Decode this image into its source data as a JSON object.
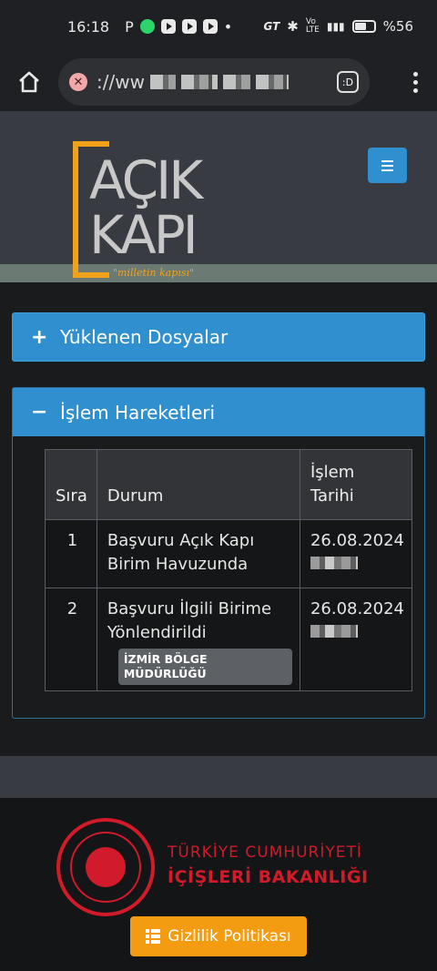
{
  "status_bar": {
    "time": "16:18",
    "app_letter": "P",
    "network": "GT",
    "battery": "%56"
  },
  "browser": {
    "url_prefix": "://ww",
    "extension_label": ":D"
  },
  "header": {
    "logo_line1": "AÇIK",
    "logo_line2": "KAPI",
    "logo_tagline": "\"milletin kapısı\""
  },
  "panels": {
    "uploaded": {
      "icon": "+",
      "title": "Yüklenen Dosyalar"
    },
    "history": {
      "icon": "−",
      "title": "İşlem Hareketleri"
    }
  },
  "table": {
    "headers": {
      "order": "Sıra",
      "status": "Durum",
      "date": "İşlem Tarihi"
    },
    "rows": [
      {
        "order": "1",
        "status": "Başvuru Açık Kapı Birim Havuzunda",
        "date": "26.08.2024",
        "tag": ""
      },
      {
        "order": "2",
        "status": "Başvuru İlgili Birime Yönlendirildi",
        "date": "26.08.2024",
        "tag": "İZMİR BÖLGE MÜDÜRLÜĞÜ"
      }
    ]
  },
  "footer": {
    "ministry_line1": "TÜRKİYE CUMHURİYETİ",
    "ministry_line2": "İÇİŞLERİ BAKANLIĞI",
    "privacy_button": "Gizlilik Politikası"
  }
}
